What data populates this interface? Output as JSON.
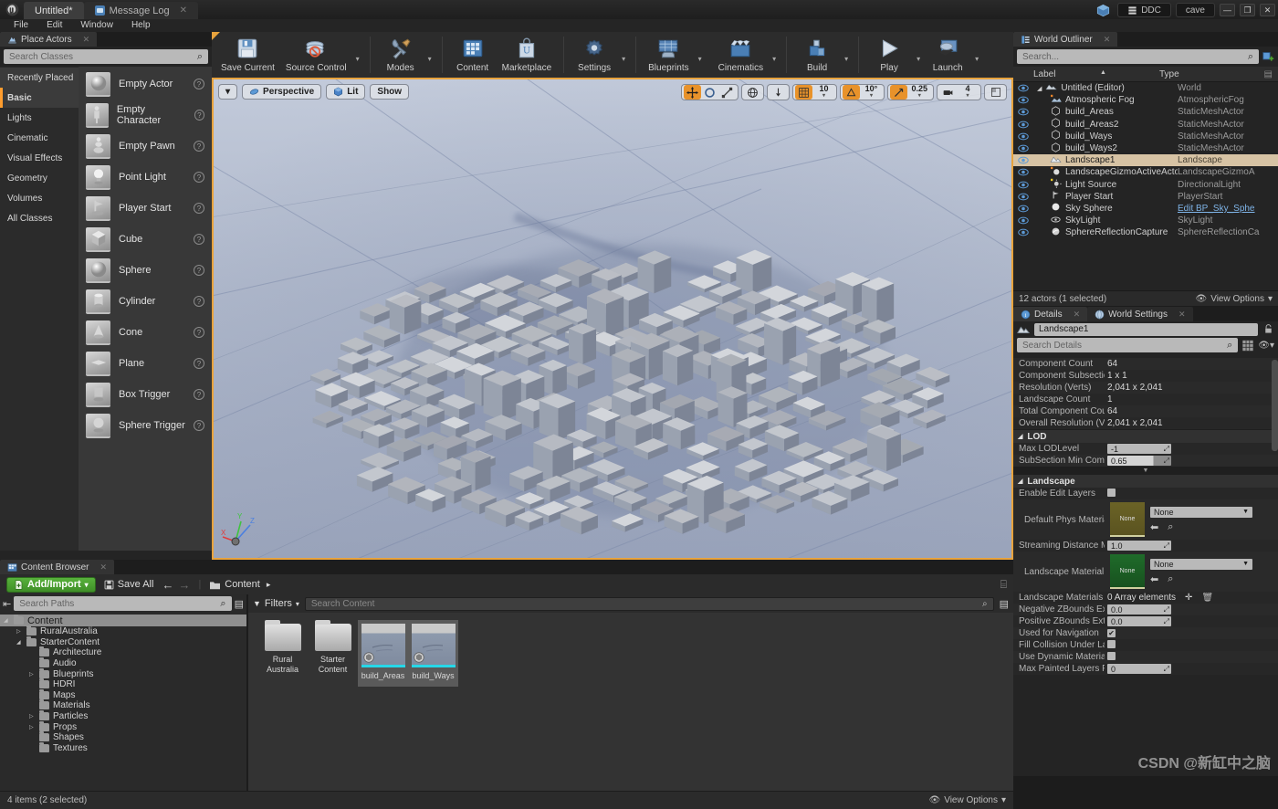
{
  "titlebar": {
    "project_tab": "Untitled*",
    "message_log_tab": "Message Log",
    "ddc_label": "DDC",
    "user_label": "cave"
  },
  "menubar": {
    "items": [
      "File",
      "Edit",
      "Window",
      "Help"
    ]
  },
  "place_actors": {
    "tab_label": "Place Actors",
    "search_placeholder": "Search Classes",
    "categories": [
      "Recently Placed",
      "Basic",
      "Lights",
      "Cinematic",
      "Visual Effects",
      "Geometry",
      "Volumes",
      "All Classes"
    ],
    "active_category": "Basic",
    "items": [
      {
        "label": "Empty Actor",
        "icon": "sphere-icon"
      },
      {
        "label": "Empty Character",
        "icon": "character-icon"
      },
      {
        "label": "Empty Pawn",
        "icon": "pawn-icon"
      },
      {
        "label": "Point Light",
        "icon": "bulb-icon"
      },
      {
        "label": "Player Start",
        "icon": "flag-icon"
      },
      {
        "label": "Cube",
        "icon": "cube-icon"
      },
      {
        "label": "Sphere",
        "icon": "sphere-icon"
      },
      {
        "label": "Cylinder",
        "icon": "cylinder-icon"
      },
      {
        "label": "Cone",
        "icon": "cone-icon"
      },
      {
        "label": "Plane",
        "icon": "plane-icon"
      },
      {
        "label": "Box Trigger",
        "icon": "box-trigger-icon"
      },
      {
        "label": "Sphere Trigger",
        "icon": "sphere-trigger-icon"
      }
    ]
  },
  "toolbar": {
    "buttons": [
      {
        "label": "Save Current",
        "icon": "floppy-icon",
        "caret": false
      },
      {
        "label": "Source Control",
        "icon": "source-control-icon",
        "caret": true
      },
      {
        "label": "Modes",
        "icon": "wrench-icon",
        "caret": true
      },
      {
        "label": "Content",
        "icon": "content-icon",
        "caret": false
      },
      {
        "label": "Marketplace",
        "icon": "marketplace-bag-icon",
        "caret": false
      },
      {
        "label": "Settings",
        "icon": "gear-icon",
        "caret": true
      },
      {
        "label": "Blueprints",
        "icon": "blueprint-icon",
        "caret": true
      },
      {
        "label": "Cinematics",
        "icon": "clapperboard-icon",
        "caret": true
      },
      {
        "label": "Build",
        "icon": "build-icon",
        "caret": true
      },
      {
        "label": "Play",
        "icon": "play-icon",
        "caret": true
      },
      {
        "label": "Launch",
        "icon": "launch-icon",
        "caret": true
      }
    ]
  },
  "viewport": {
    "perspective_label": "Perspective",
    "lit_label": "Lit",
    "show_label": "Show",
    "grid_snap_value": "10",
    "rotation_snap_value": "10°",
    "scale_snap_value": "0.25",
    "camera_speed_value": "4",
    "axis_labels": {
      "x": "X",
      "y": "Y",
      "z": "Z"
    }
  },
  "outliner": {
    "tab_label": "World Outliner",
    "search_placeholder": "Search...",
    "col_label": "Label",
    "col_type": "Type",
    "rows": [
      {
        "label": "Untitled (Editor)",
        "type": "World",
        "indent": 0,
        "selected": false,
        "icon": "world-icon",
        "link": false
      },
      {
        "label": "Atmospheric Fog",
        "type": "AtmosphericFog",
        "indent": 1,
        "selected": false,
        "icon": "fog-icon",
        "link": false
      },
      {
        "label": "build_Areas",
        "type": "StaticMeshActor",
        "indent": 1,
        "selected": false,
        "icon": "mesh-icon",
        "link": false
      },
      {
        "label": "build_Areas2",
        "type": "StaticMeshActor",
        "indent": 1,
        "selected": false,
        "icon": "mesh-icon",
        "link": false
      },
      {
        "label": "build_Ways",
        "type": "StaticMeshActor",
        "indent": 1,
        "selected": false,
        "icon": "mesh-icon",
        "link": false
      },
      {
        "label": "build_Ways2",
        "type": "StaticMeshActor",
        "indent": 1,
        "selected": false,
        "icon": "mesh-icon",
        "link": false
      },
      {
        "label": "Landscape1",
        "type": "Landscape",
        "indent": 1,
        "selected": true,
        "icon": "landscape-icon",
        "link": false
      },
      {
        "label": "LandscapeGizmoActiveActor",
        "type": "LandscapeGizmoA",
        "indent": 1,
        "selected": false,
        "icon": "gizmo-icon",
        "link": false
      },
      {
        "label": "Light Source",
        "type": "DirectionalLight",
        "indent": 1,
        "selected": false,
        "icon": "light-icon",
        "link": false
      },
      {
        "label": "Player Start",
        "type": "PlayerStart",
        "indent": 1,
        "selected": false,
        "icon": "playerstart-icon",
        "link": false
      },
      {
        "label": "Sky Sphere",
        "type": "Edit BP_Sky_Sphe",
        "indent": 1,
        "selected": false,
        "icon": "sky-icon",
        "link": true
      },
      {
        "label": "SkyLight",
        "type": "SkyLight",
        "indent": 1,
        "selected": false,
        "icon": "skylight-icon",
        "link": false
      },
      {
        "label": "SphereReflectionCapture",
        "type": "SphereReflectionCa",
        "indent": 1,
        "selected": false,
        "icon": "reflection-icon",
        "link": false
      }
    ],
    "status": "12 actors (1 selected)",
    "view_options": "View Options"
  },
  "details": {
    "tab_details": "Details",
    "tab_world_settings": "World Settings",
    "actor_name": "Landscape1",
    "search_placeholder": "Search Details",
    "info_rows": [
      {
        "label": "Component Count",
        "value": "64"
      },
      {
        "label": "Component Subsection",
        "value": "1 x 1"
      },
      {
        "label": "Resolution (Verts)",
        "value": "2,041 x 2,041"
      },
      {
        "label": "Landscape Count",
        "value": "1"
      },
      {
        "label": "Total Component Coun",
        "value": "64"
      },
      {
        "label": "Overall Resolution (Ve",
        "value": "2,041 x 2,041"
      }
    ],
    "section_lod": "LOD",
    "lod_rows": [
      {
        "label": "Max LODLevel",
        "value": "-1"
      },
      {
        "label": "SubSection Min Compo",
        "value": "0.65"
      }
    ],
    "section_landscape": "Landscape",
    "enable_edit_layers_label": "Enable Edit Layers",
    "enable_edit_layers_checked": false,
    "default_phys_material_label": "Default Phys Material",
    "default_phys_material_value": "None",
    "default_phys_material_swatch": "None",
    "streaming_distance_label": "Streaming Distance Mu",
    "streaming_distance_value": "1.0",
    "landscape_material_label": "Landscape Material",
    "landscape_material_value": "None",
    "landscape_material_swatch": "None",
    "landscape_materials_override_label": "Landscape Materials O",
    "landscape_materials_override_value": "0 Array elements",
    "bottom_rows": [
      {
        "label": "Negative ZBounds Exte",
        "value": "0.0",
        "type": "field"
      },
      {
        "label": "Positive ZBounds Exte",
        "value": "0.0",
        "type": "field"
      },
      {
        "label": "Used for Navigation",
        "value": "checked",
        "type": "check"
      },
      {
        "label": "Fill Collision Under Lan",
        "value": "unchecked",
        "type": "check"
      },
      {
        "label": "Use Dynamic Material",
        "value": "unchecked",
        "type": "check"
      },
      {
        "label": "Max Painted Layers Pe",
        "value": "0",
        "type": "field"
      }
    ]
  },
  "content_browser": {
    "tab_label": "Content Browser",
    "add_import_label": "Add/Import",
    "save_all_label": "Save All",
    "breadcrumb_label": "Content",
    "paths_placeholder": "Search Paths",
    "filters_label": "Filters",
    "search_placeholder": "Search Content",
    "tree": [
      {
        "label": "Content",
        "depth": 0,
        "expandable": true,
        "expanded": true,
        "selected": true
      },
      {
        "label": "RuralAustralia",
        "depth": 1,
        "expandable": true,
        "expanded": false,
        "selected": false
      },
      {
        "label": "StarterContent",
        "depth": 1,
        "expandable": true,
        "expanded": true,
        "selected": false
      },
      {
        "label": "Architecture",
        "depth": 2,
        "expandable": false,
        "expanded": false,
        "selected": false
      },
      {
        "label": "Audio",
        "depth": 2,
        "expandable": false,
        "expanded": false,
        "selected": false
      },
      {
        "label": "Blueprints",
        "depth": 2,
        "expandable": true,
        "expanded": false,
        "selected": false
      },
      {
        "label": "HDRI",
        "depth": 2,
        "expandable": false,
        "expanded": false,
        "selected": false
      },
      {
        "label": "Maps",
        "depth": 2,
        "expandable": false,
        "expanded": false,
        "selected": false
      },
      {
        "label": "Materials",
        "depth": 2,
        "expandable": false,
        "expanded": false,
        "selected": false
      },
      {
        "label": "Particles",
        "depth": 2,
        "expandable": true,
        "expanded": false,
        "selected": false
      },
      {
        "label": "Props",
        "depth": 2,
        "expandable": true,
        "expanded": false,
        "selected": false
      },
      {
        "label": "Shapes",
        "depth": 2,
        "expandable": false,
        "expanded": false,
        "selected": false
      },
      {
        "label": "Textures",
        "depth": 2,
        "expandable": false,
        "expanded": false,
        "selected": false
      }
    ],
    "assets": [
      {
        "label": "Rural\nAustralia",
        "kind": "folder",
        "selected": false
      },
      {
        "label": "Starter\nContent",
        "kind": "folder",
        "selected": false
      },
      {
        "label": "build_Areas",
        "kind": "mesh",
        "selected": true
      },
      {
        "label": "build_Ways",
        "kind": "mesh",
        "selected": true
      }
    ],
    "status": "4 items (2 selected)",
    "view_options": "View Options"
  },
  "watermark": "CSDN @新缸中之脑",
  "colors": {
    "accent_orange": "#e8a33d",
    "selection_tan": "#d7c3a4",
    "green_button": "#4da32c",
    "link_blue": "#7fb4e8",
    "asset_cyan": "#26d7e8"
  }
}
